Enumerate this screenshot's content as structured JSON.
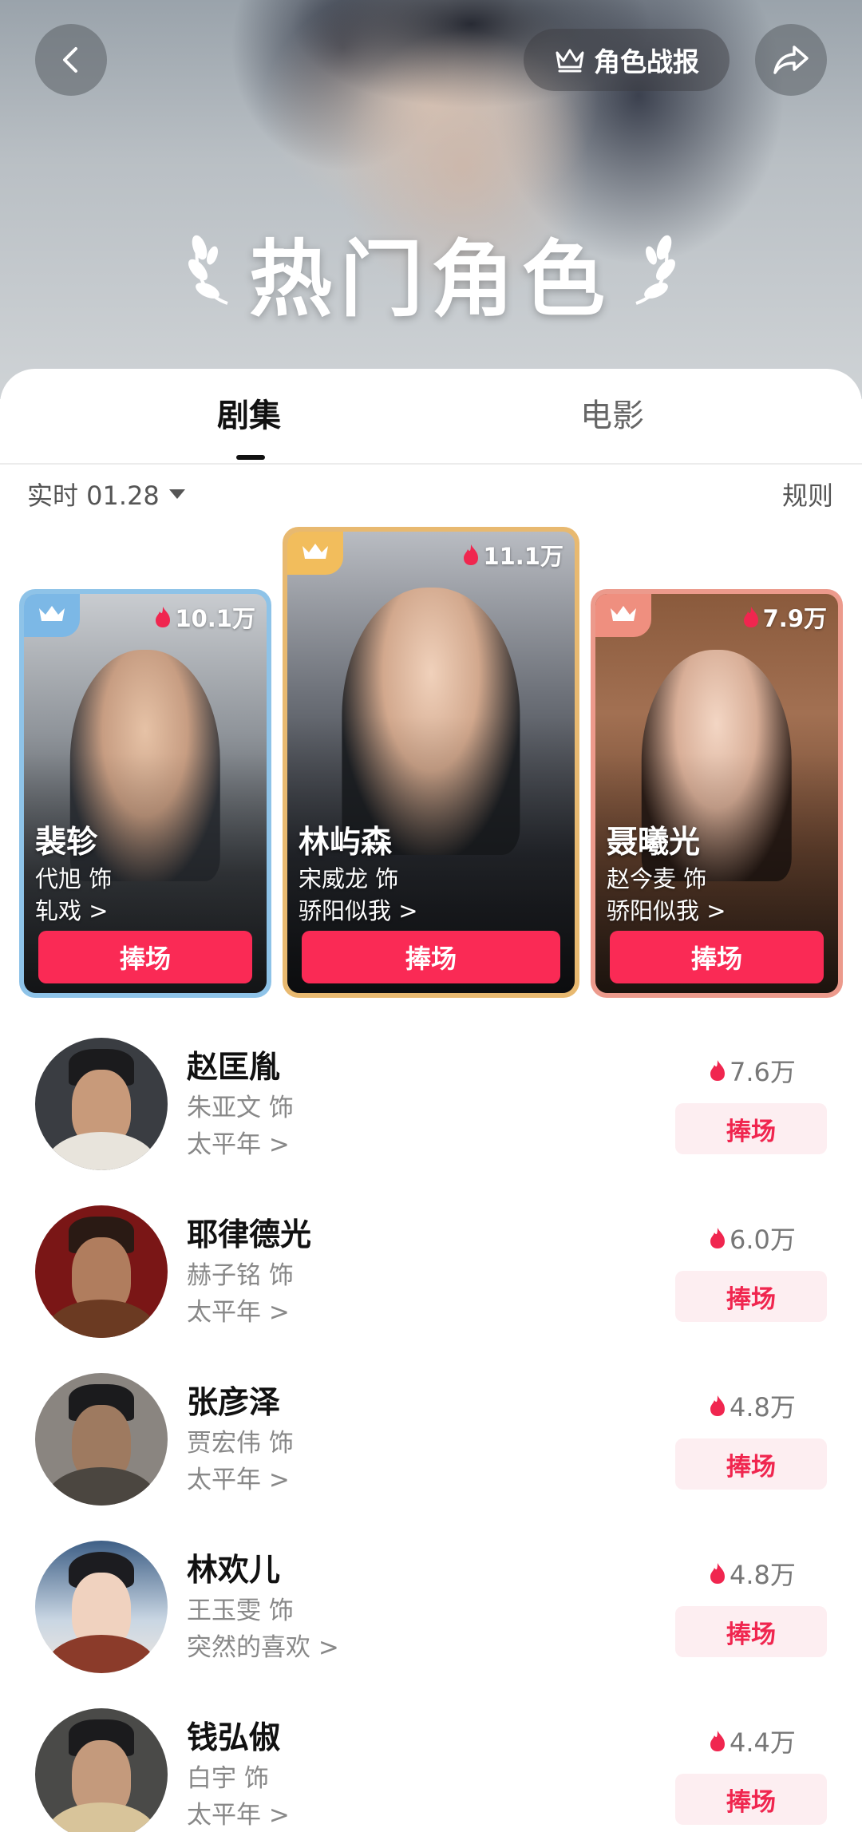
{
  "header": {
    "report_label": "角色战报",
    "title": "热门角色"
  },
  "tabs": [
    {
      "label": "剧集",
      "active": true
    },
    {
      "label": "电影",
      "active": false
    }
  ],
  "filter": {
    "date_label": "实时 01.28",
    "rules_label": "规则"
  },
  "podium": [
    {
      "rank": 2,
      "heat": "10.1万",
      "name": "裴轸",
      "actor": "代旭 饰",
      "show": "轧戏 >",
      "button": "捧场",
      "frame_color": "#8ec3e8"
    },
    {
      "rank": 1,
      "heat": "11.1万",
      "name": "林屿森",
      "actor": "宋威龙 饰",
      "show": "骄阳似我 >",
      "button": "捧场",
      "frame_color": "#e8b970"
    },
    {
      "rank": 3,
      "heat": "7.9万",
      "name": "聂曦光",
      "actor": "赵今麦 饰",
      "show": "骄阳似我 >",
      "button": "捧场",
      "frame_color": "#ec9a8c"
    }
  ],
  "list": [
    {
      "heat": "7.6万",
      "name": "赵匡胤",
      "actor": "朱亚文 饰",
      "show": "太平年 >",
      "button": "捧场"
    },
    {
      "heat": "6.0万",
      "name": "耶律德光",
      "actor": "赫子铭 饰",
      "show": "太平年 >",
      "button": "捧场"
    },
    {
      "heat": "4.8万",
      "name": "张彦泽",
      "actor": "贾宏伟 饰",
      "show": "太平年 >",
      "button": "捧场"
    },
    {
      "heat": "4.8万",
      "name": "林欢儿",
      "actor": "王玉雯 饰",
      "show": "突然的喜欢 >",
      "button": "捧场"
    },
    {
      "heat": "4.4万",
      "name": "钱弘俶",
      "actor": "白宇 饰",
      "show": "太平年 >",
      "button": "捧场"
    }
  ],
  "colors": {
    "accent": "#fa2a55",
    "soft_button": "#fdeef1",
    "flame": "#f0264f"
  }
}
